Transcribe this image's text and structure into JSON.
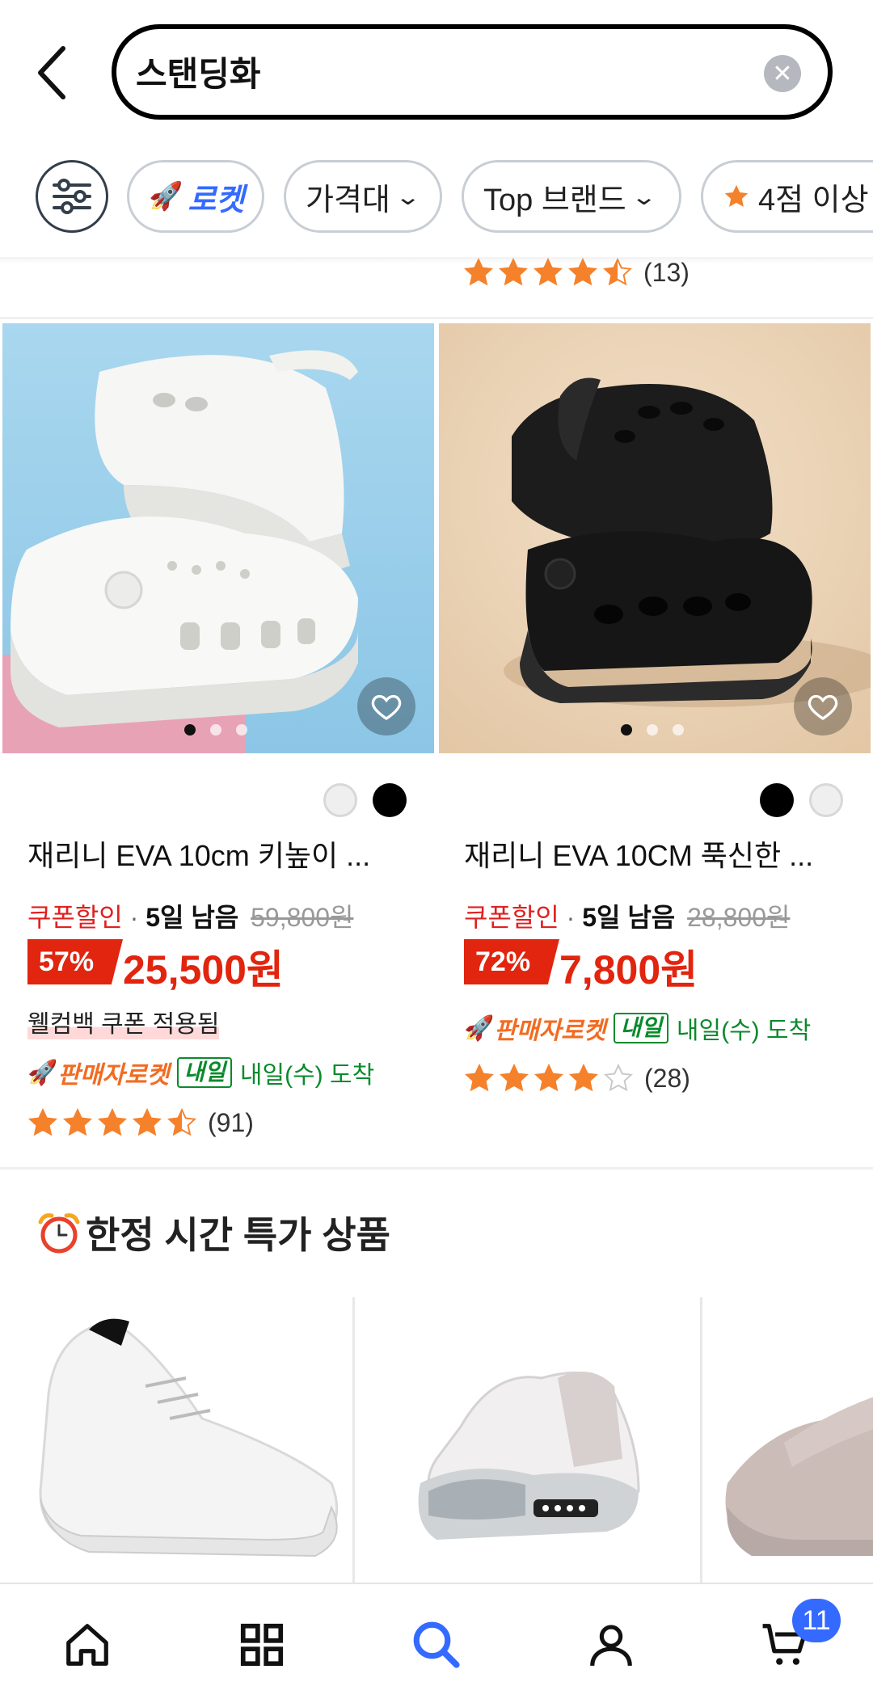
{
  "search": {
    "query": "스탠딩화"
  },
  "filters": {
    "rocket_label": "로켓",
    "price_label": "가격대",
    "brand_label": "Top 브랜드",
    "rating_label": "4점 이상"
  },
  "prev_product": {
    "rating": 4.5,
    "rating_count": "(13)"
  },
  "products": [
    {
      "title": "재리니 EVA 10cm 키높이 ...",
      "coupon_label": "쿠폰할인",
      "days_left": "5일 남음",
      "original_price": "59,800원",
      "discount": "57%",
      "price": "25,500원",
      "welcome_coupon": "웰컴백 쿠폰 적용됨",
      "seller_rocket": "판매자로켓",
      "tomorrow_badge": "내일",
      "arrival": "내일(수) 도착",
      "rating": 4.5,
      "rating_count": "(91)",
      "swatches": [
        "white",
        "black"
      ],
      "image_page": 1,
      "image_pages": 3
    },
    {
      "title": "재리니 EVA 10CM 푹신한 ...",
      "coupon_label": "쿠폰할인",
      "days_left": "5일 남음",
      "original_price": "28,800원",
      "discount": "72%",
      "price": "7,800원",
      "seller_rocket": "판매자로켓",
      "tomorrow_badge": "내일",
      "arrival": "내일(수) 도착",
      "rating": 4,
      "rating_count": "(28)",
      "swatches": [
        "black",
        "white"
      ],
      "image_page": 1,
      "image_pages": 3
    }
  ],
  "limited_section": {
    "title": "한정 시간 특가 상품"
  },
  "bottom_nav": {
    "items": [
      "home-icon",
      "categories-icon",
      "search-icon",
      "account-icon",
      "cart-icon"
    ],
    "cart_count": "11"
  },
  "colors": {
    "brand_blue": "#346aff",
    "sale_red": "#e1250f",
    "star_orange": "#f5812b",
    "delivery_green": "#0a8a2c",
    "seller_rocket_orange": "#f26b21"
  }
}
